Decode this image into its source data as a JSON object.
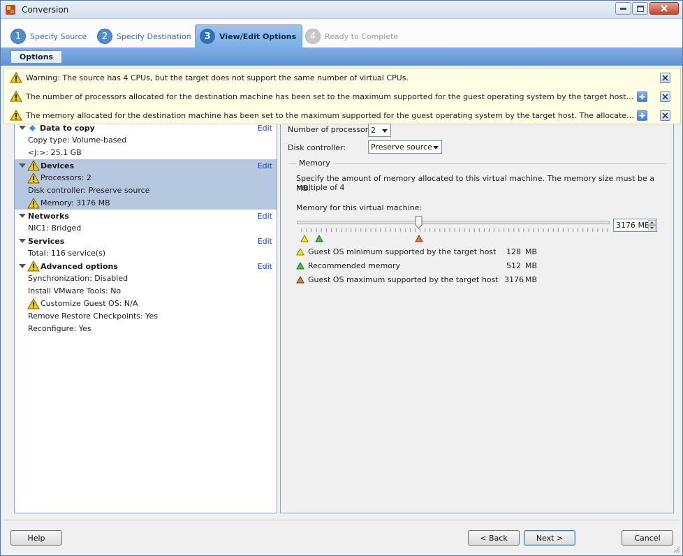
{
  "window": {
    "title": "Conversion"
  },
  "wizard": {
    "steps": [
      {
        "num": "1",
        "label": "Specify Source"
      },
      {
        "num": "2",
        "label": "Specify Destination"
      },
      {
        "num": "3",
        "label": "View/Edit Options"
      },
      {
        "num": "4",
        "label": "Ready to Complete"
      }
    ]
  },
  "options_tab": "Options",
  "warnings": [
    "Warning: The source has 4 CPUs, but the target does not support the same number of virtual CPUs.",
    "The number of processors allocated for the destination machine has been set to the maximum supported for the guest operating system by the target host. The allocated processo...",
    "The memory allocated for the destination machine has been set to the maximum supported for the guest operating system by the target host. The allocated memory is less than th..."
  ],
  "tree": {
    "edit_label": "Edit",
    "data_to_copy": {
      "title": "Data to copy",
      "copy_type": "Copy type: Volume-based",
      "volume": "<J:>: 25.1 GB"
    },
    "devices": {
      "title": "Devices",
      "processors": "Processors: 2",
      "disk_controller": "Disk controller: Preserve source",
      "memory": "Memory: 3176 MB"
    },
    "networks": {
      "title": "Networks",
      "nic": "NIC1: Bridged"
    },
    "services": {
      "title": "Services",
      "total": "Total: 116 service(s)"
    },
    "advanced": {
      "title": "Advanced options",
      "sync": "Synchronization: Disabled",
      "tools": "Install VMware Tools: No",
      "customize": "Customize Guest OS: N/A",
      "checkpoints": "Remove Restore Checkpoints: Yes",
      "reconfigure": "Reconfigure: Yes"
    }
  },
  "devices_panel": {
    "processors_label": "Number of processors:",
    "processors_value": "2",
    "disk_label": "Disk controller:",
    "disk_value": "Preserve source",
    "memory_group": "Memory",
    "memory_desc_1": "Specify the amount of memory allocated to this virtual machine. The memory size must be a multiple of 4",
    "memory_desc_2": "MB.",
    "memory_for_vm": "Memory for this virtual machine:",
    "memory_value": "3176 MB",
    "slider_level_fraction": 0.39,
    "legend": [
      {
        "label": "Guest OS minimum supported by the target host",
        "value": "128",
        "unit": "MB",
        "color": "#f2e52a"
      },
      {
        "label": "Recommended memory",
        "value": "512",
        "unit": "MB",
        "color": "#3cc23c"
      },
      {
        "label": "Guest OS maximum supported by the target host",
        "value": "3176",
        "unit": "MB",
        "color": "#e07a3c"
      }
    ]
  },
  "buttons": {
    "help": "Help",
    "back": "< Back",
    "next": "Next >",
    "cancel": "Cancel"
  }
}
